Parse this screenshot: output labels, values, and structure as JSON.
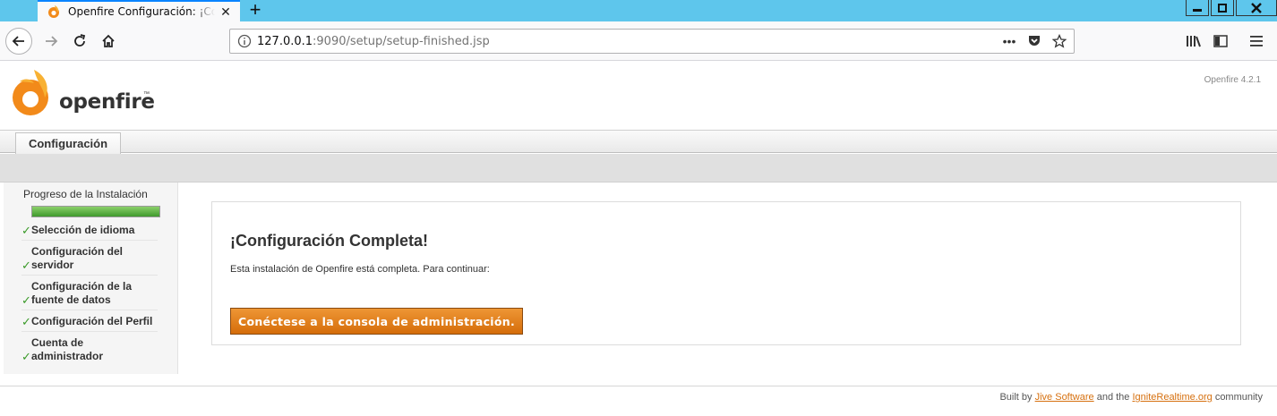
{
  "browser": {
    "tab_title": "Openfire Configuración: ¡Configuración Completa!",
    "new_tab_symbol": "+",
    "tab_close_symbol": "✕",
    "url_host": "127.0.0.1",
    "url_rest": ":9090/setup/setup-finished.jsp",
    "page_actions_symbol": "•••",
    "icons": [
      "firefox-openfire-favicon",
      "back-icon",
      "forward-icon",
      "reload-icon",
      "home-icon",
      "info-icon",
      "pocket-icon",
      "bookmark-star-icon",
      "library-icon",
      "sidebar-icon",
      "menu-icon"
    ],
    "accent_color": "#5ec6ec"
  },
  "header": {
    "logo_text": "openfire",
    "logo_tm": "™",
    "version": "Openfire 4.2.1"
  },
  "nav": {
    "tab_label": "Configuración"
  },
  "sidebar": {
    "title": "Progreso de la Instalación",
    "progress": 1.0,
    "check_symbol": "✓",
    "steps": [
      "Selección de idioma",
      "Configuración del servidor",
      "Configuración de la fuente de datos",
      "Configuración del Perfil",
      "Cuenta de administrador"
    ]
  },
  "main": {
    "heading": "¡Configuración Completa!",
    "description": "Esta instalación de Openfire está completa. Para continuar:",
    "button_label": "Conéctese a la consola de administración.",
    "button_color": "#e07e1f"
  },
  "footer": {
    "prefix": "Built by",
    "link1": "Jive Software",
    "middle": "and the",
    "link2": "IgniteRealtime.org",
    "suffix": "community"
  }
}
